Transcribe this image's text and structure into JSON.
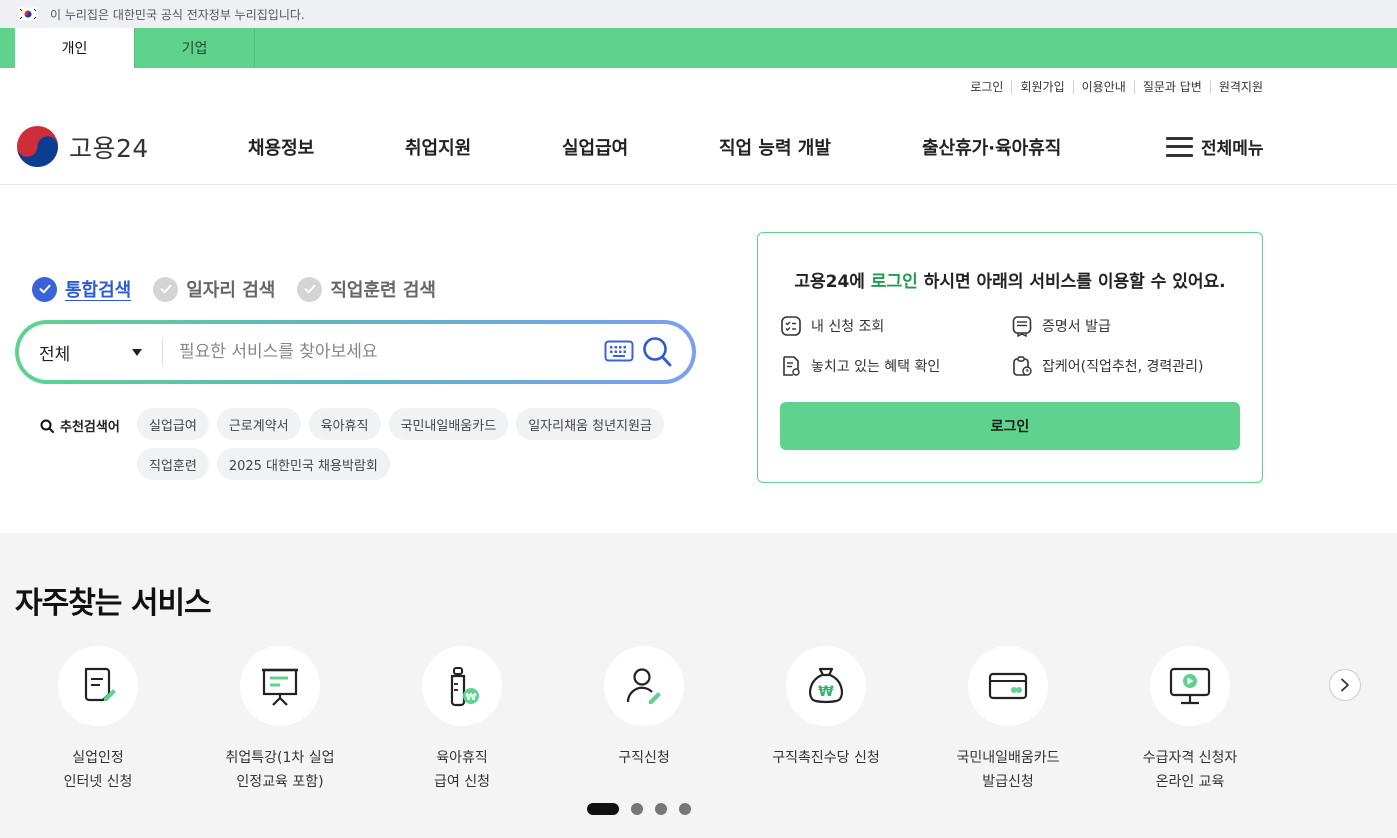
{
  "gov_banner": {
    "text": "이 누리집은 대한민국 공식 전자정부 누리집입니다."
  },
  "audience_tabs": [
    {
      "label": "개인",
      "active": true
    },
    {
      "label": "기업",
      "active": false
    }
  ],
  "util_links": [
    "로그인",
    "회원가입",
    "이용안내",
    "질문과 답변",
    "원격지원"
  ],
  "logo": {
    "text": "고용24"
  },
  "gnb": [
    "채용정보",
    "취업지원",
    "실업급여",
    "직업 능력 개발",
    "출산휴가·육아휴직"
  ],
  "all_menu": {
    "label": "전체메뉴"
  },
  "search": {
    "tabs": [
      {
        "label": "통합검색",
        "active": true
      },
      {
        "label": "일자리 검색",
        "active": false
      },
      {
        "label": "직업훈련 검색",
        "active": false
      }
    ],
    "category": "전체",
    "placeholder": "필요한 서비스를 찾아보세요",
    "recommended_label": "추천검색어",
    "recommended": [
      "실업급여",
      "근로계약서",
      "육아휴직",
      "국민내일배움카드",
      "일자리채움 청년지원금",
      "직업훈련",
      "2025 대한민국 채용박람회"
    ]
  },
  "login_card": {
    "title_pre": "고용24에 ",
    "title_em": "로그인",
    "title_post": " 하시면 아래의 서비스를 이용할 수 있어요.",
    "items": [
      "내 신청 조회",
      "증명서 발급",
      "놓치고 있는 혜택 확인",
      "잡케어(직업추천, 경력관리)"
    ],
    "button": "로그인"
  },
  "frequent": {
    "title": "자주찾는 서비스",
    "services": [
      {
        "label": "실업인정\n인터넷 신청",
        "icon": "document-pen-icon"
      },
      {
        "label": "취업특강(1차 실업\n인정교육 포함)",
        "icon": "presentation-board-icon"
      },
      {
        "label": "육아휴직\n급여 신청",
        "icon": "baby-bottle-won-icon"
      },
      {
        "label": "구직신청",
        "icon": "person-pen-icon"
      },
      {
        "label": "구직촉진수당 신청",
        "icon": "money-bag-won-icon"
      },
      {
        "label": "국민내일배움카드\n발급신청",
        "icon": "card-icon"
      },
      {
        "label": "수급자격 신청자\n온라인 교육",
        "icon": "monitor-play-icon"
      }
    ],
    "pagination_count": 4,
    "pagination_active": 1
  },
  "colors": {
    "brand_green": "#5fd38d",
    "brand_blue": "#3b63d9",
    "text_green": "#1e9e4e"
  }
}
